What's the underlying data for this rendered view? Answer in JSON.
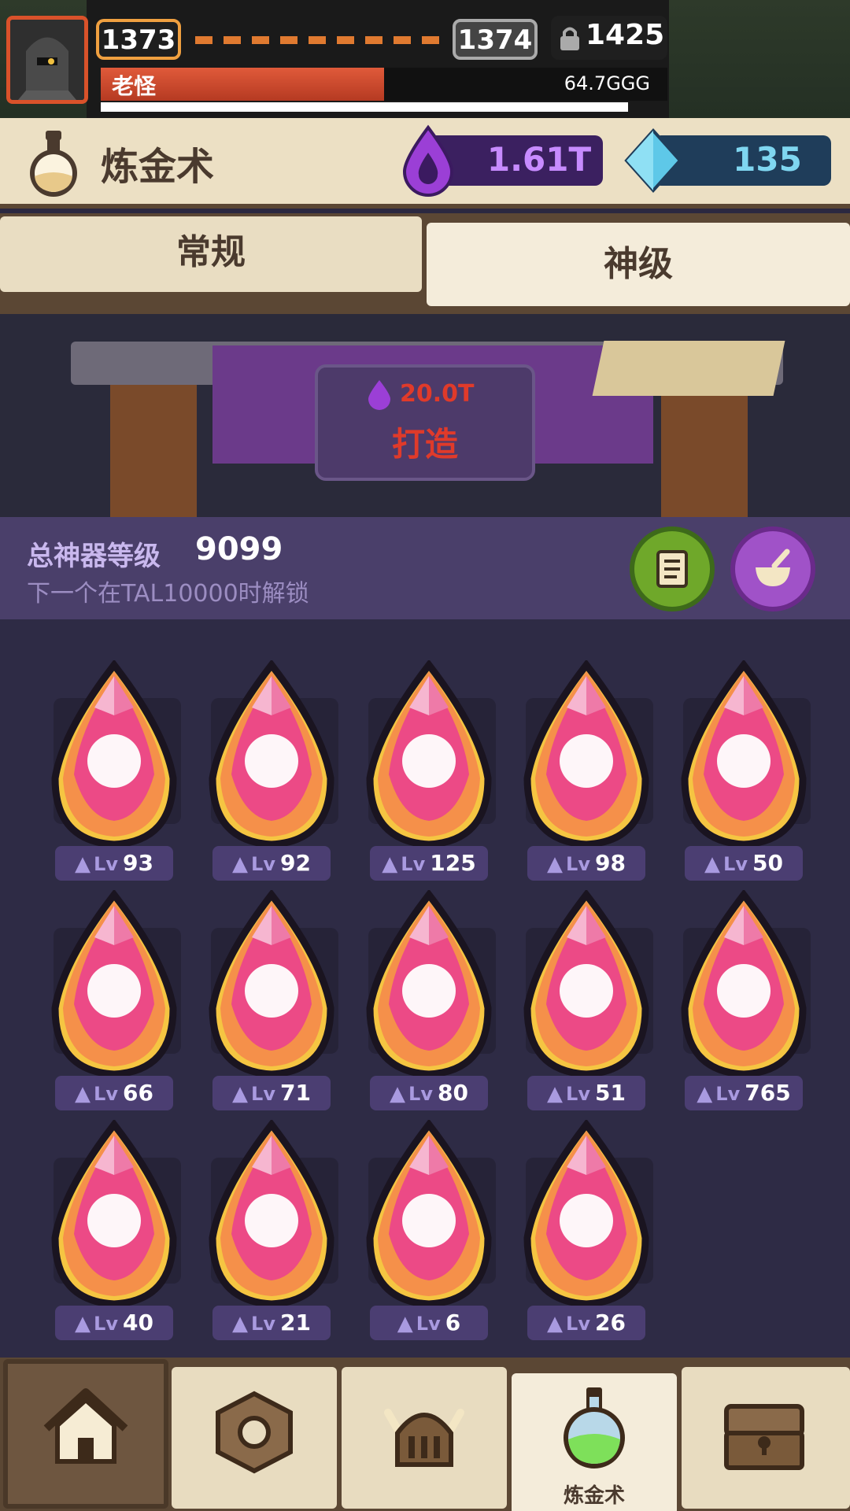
{
  "hud": {
    "level_current": "1373",
    "level_next": "1374",
    "lock_value": "1425",
    "boss_name": "老怪",
    "boss_hp": "64.7GGG",
    "boss_hp_fraction": 0.5
  },
  "header": {
    "title": "炼金术",
    "purple_currency": "1.61T",
    "blue_currency": "135"
  },
  "tabs": [
    {
      "label": "常规",
      "active": false
    },
    {
      "label": "神级",
      "active": true
    }
  ],
  "forge": {
    "cost": "20.0T",
    "label": "打造"
  },
  "summary": {
    "label": "总神器等级",
    "value": "9099",
    "sub": "下一个在TAL10000时解锁"
  },
  "artifacts": [
    {
      "icon": "heart-plus-icon",
      "lv": "93"
    },
    {
      "icon": "sword-icon",
      "lv": "92"
    },
    {
      "icon": "portal-walker-icon",
      "lv": "125"
    },
    {
      "icon": "coins-icon",
      "lv": "98"
    },
    {
      "icon": "arrow-up-icon",
      "lv": "50"
    },
    {
      "icon": "heart-coins-hand-icon",
      "lv": "66"
    },
    {
      "icon": "goblin-head-icon",
      "lv": "71"
    },
    {
      "icon": "tap-finger-icon",
      "lv": "80"
    },
    {
      "icon": "lightning-potion-icon",
      "lv": "51"
    },
    {
      "icon": "sparkles-icon",
      "lv": "765"
    },
    {
      "icon": "planet-icon",
      "lv": "40"
    },
    {
      "icon": "shield-skull-icon",
      "lv": "21"
    },
    {
      "icon": "dragon-icon",
      "lv": "6"
    },
    {
      "icon": "fist-burst-icon",
      "lv": "26"
    }
  ],
  "level_prefix": "Lv",
  "nav": {
    "alchemy_label": "炼金术"
  },
  "colors": {
    "gem_pink": "#ec4a86",
    "gem_orange": "#f5904a",
    "gem_yellow": "#f5c542",
    "panel_purple": "#4a3f6a",
    "tan": "#ece0c4"
  }
}
